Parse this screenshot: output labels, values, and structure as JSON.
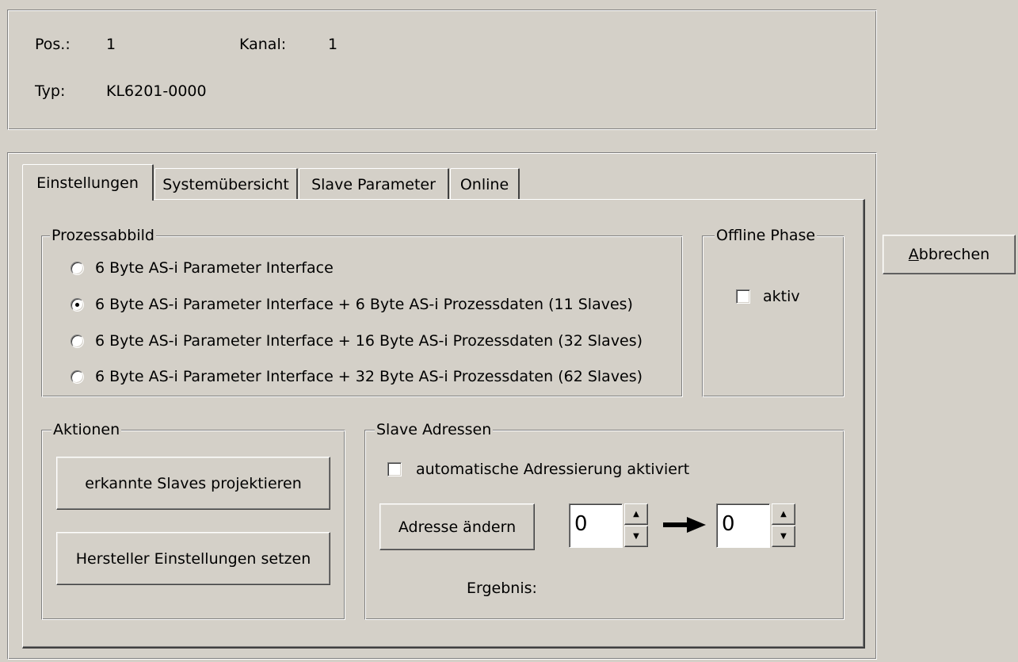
{
  "header": {
    "pos_label": "Pos.:",
    "pos_value": "1",
    "kanal_label": "Kanal:",
    "kanal_value": "1",
    "typ_label": "Typ:",
    "typ_value": "KL6201-0000"
  },
  "tabs": [
    {
      "label": "Einstellungen",
      "active": true
    },
    {
      "label": "Systemübersicht",
      "active": false
    },
    {
      "label": "Slave Parameter",
      "active": false
    },
    {
      "label": "Online",
      "active": false
    }
  ],
  "prozessabbild": {
    "title": "Prozessabbild",
    "options": [
      {
        "label": "6 Byte AS-i Parameter Interface",
        "selected": false
      },
      {
        "label": "6 Byte AS-i Parameter Interface + 6 Byte AS-i Prozessdaten (11 Slaves)",
        "selected": true
      },
      {
        "label": "6 Byte AS-i Parameter Interface + 16 Byte AS-i Prozessdaten (32 Slaves)",
        "selected": false
      },
      {
        "label": "6 Byte AS-i Parameter Interface + 32 Byte AS-i Prozessdaten (62 Slaves)",
        "selected": false
      }
    ]
  },
  "offline_phase": {
    "title": "Offline Phase",
    "checkbox_label": "aktiv",
    "checked": false
  },
  "aktionen": {
    "title": "Aktionen",
    "button_projektieren": "erkannte Slaves projektieren",
    "button_hersteller": "Hersteller Einstellungen setzen"
  },
  "slave_adressen": {
    "title": "Slave Adressen",
    "auto_label": "automatische Adressierung aktiviert",
    "auto_checked": false,
    "change_button": "Adresse ändern",
    "from_value": "0",
    "to_value": "0",
    "arrow_icon": "arrow-right-icon",
    "result_label": "Ergebnis:"
  },
  "dialog": {
    "cancel_prefix": "A",
    "cancel_rest": "bbrechen"
  }
}
